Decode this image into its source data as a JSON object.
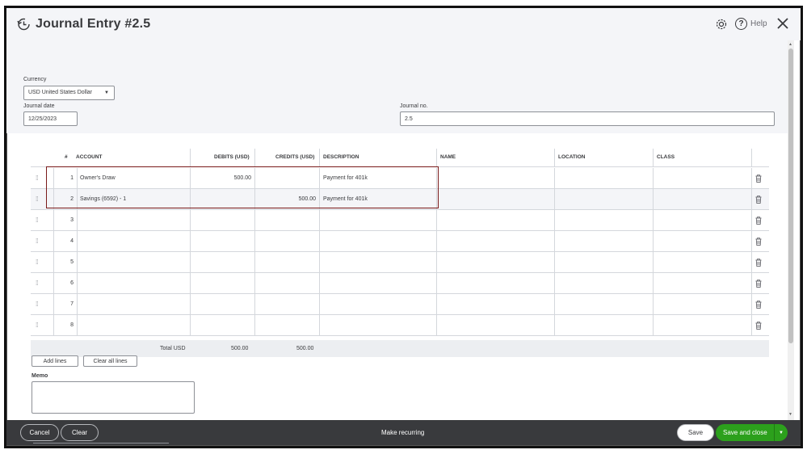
{
  "header": {
    "title": "Journal Entry #2.5",
    "help_label": "Help",
    "help_glyph": "?"
  },
  "form": {
    "currency_label": "Currency",
    "currency_value": "USD United States Dollar",
    "journal_date_label": "Journal date",
    "journal_date_value": "12/25/2023",
    "journal_no_label": "Journal no.",
    "journal_no_value": "2.5"
  },
  "table": {
    "headers": {
      "num": "#",
      "account": "ACCOUNT",
      "debits": "DEBITS (USD)",
      "credits": "CREDITS (USD)",
      "description": "DESCRIPTION",
      "name": "NAME",
      "location": "LOCATION",
      "class": "CLASS"
    },
    "rows": [
      {
        "num": "1",
        "account": "Owner's Draw",
        "debits": "500.00",
        "credits": "",
        "description": "Payment for 401k",
        "name": "",
        "location": "",
        "class": ""
      },
      {
        "num": "2",
        "account": "Savings (6592) - 1",
        "debits": "",
        "credits": "500.00",
        "description": "Payment for 401k",
        "name": "",
        "location": "",
        "class": ""
      },
      {
        "num": "3",
        "account": "",
        "debits": "",
        "credits": "",
        "description": "",
        "name": "",
        "location": "",
        "class": ""
      },
      {
        "num": "4",
        "account": "",
        "debits": "",
        "credits": "",
        "description": "",
        "name": "",
        "location": "",
        "class": ""
      },
      {
        "num": "5",
        "account": "",
        "debits": "",
        "credits": "",
        "description": "",
        "name": "",
        "location": "",
        "class": ""
      },
      {
        "num": "6",
        "account": "",
        "debits": "",
        "credits": "",
        "description": "",
        "name": "",
        "location": "",
        "class": ""
      },
      {
        "num": "7",
        "account": "",
        "debits": "",
        "credits": "",
        "description": "",
        "name": "",
        "location": "",
        "class": ""
      },
      {
        "num": "8",
        "account": "",
        "debits": "",
        "credits": "",
        "description": "",
        "name": "",
        "location": "",
        "class": ""
      }
    ],
    "total_label": "Total USD",
    "total_debits": "500.00",
    "total_credits": "500.00"
  },
  "actions": {
    "add_lines": "Add lines",
    "clear_all_lines": "Clear all lines"
  },
  "memo": {
    "label": "Memo",
    "value": ""
  },
  "footer": {
    "cancel": "Cancel",
    "clear": "Clear",
    "make_recurring": "Make recurring",
    "save": "Save",
    "save_and_close": "Save and close"
  },
  "colors": {
    "primary_green": "#2ca01c",
    "footer_bg": "#393a3d",
    "highlight_border": "#7a1a1a"
  },
  "icons": [
    "history-icon",
    "gear-icon",
    "help-icon",
    "close-icon",
    "drag-handle-icon",
    "trash-icon",
    "caret-down-icon"
  ]
}
